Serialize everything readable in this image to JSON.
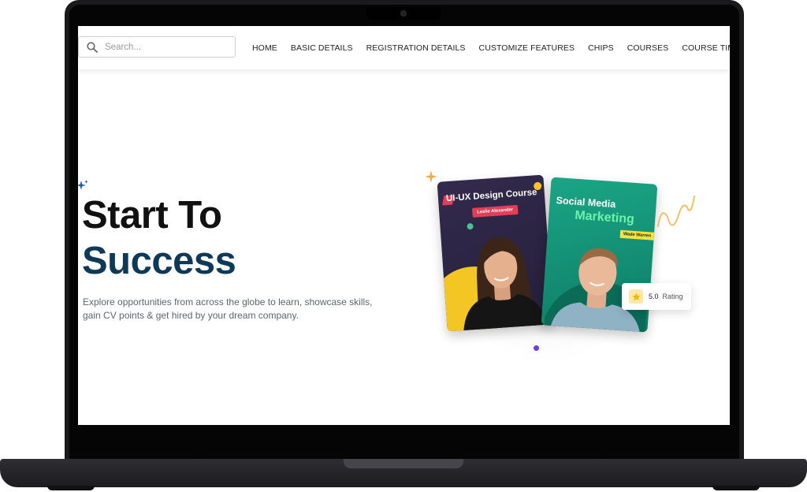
{
  "search": {
    "placeholder": "Search..."
  },
  "nav": {
    "items": [
      {
        "label": "HOME"
      },
      {
        "label": "BASIC DETAILS"
      },
      {
        "label": "REGISTRATION DETAILS"
      },
      {
        "label": "CUSTOMIZE FEATURES"
      },
      {
        "label": "CHIPS"
      },
      {
        "label": "COURSES"
      },
      {
        "label": "COURSE TIMELINES"
      }
    ]
  },
  "hero": {
    "title_line1": "Start To",
    "title_line2": "Success",
    "description": "Explore opportunities from across the globe to learn, showcase skills, gain CV points & get hired by your dream company."
  },
  "cards": [
    {
      "title": "UI-UX Design Course",
      "instructor": "Leslie Alexander"
    },
    {
      "title_line1": "Social Media",
      "title_line2": "Marketing",
      "instructor": "Wade Warren"
    }
  ],
  "rating": {
    "value": "5.0",
    "label": "Rating"
  },
  "colors": {
    "accent_navy": "#0e3a57",
    "card1_bg": "#2a2342",
    "card2_bg": "#14947a",
    "badge_red": "#e23e57",
    "badge_yellow": "#f3e33a",
    "highlight_green": "#6ff2a8",
    "star_yellow": "#f5b400"
  }
}
